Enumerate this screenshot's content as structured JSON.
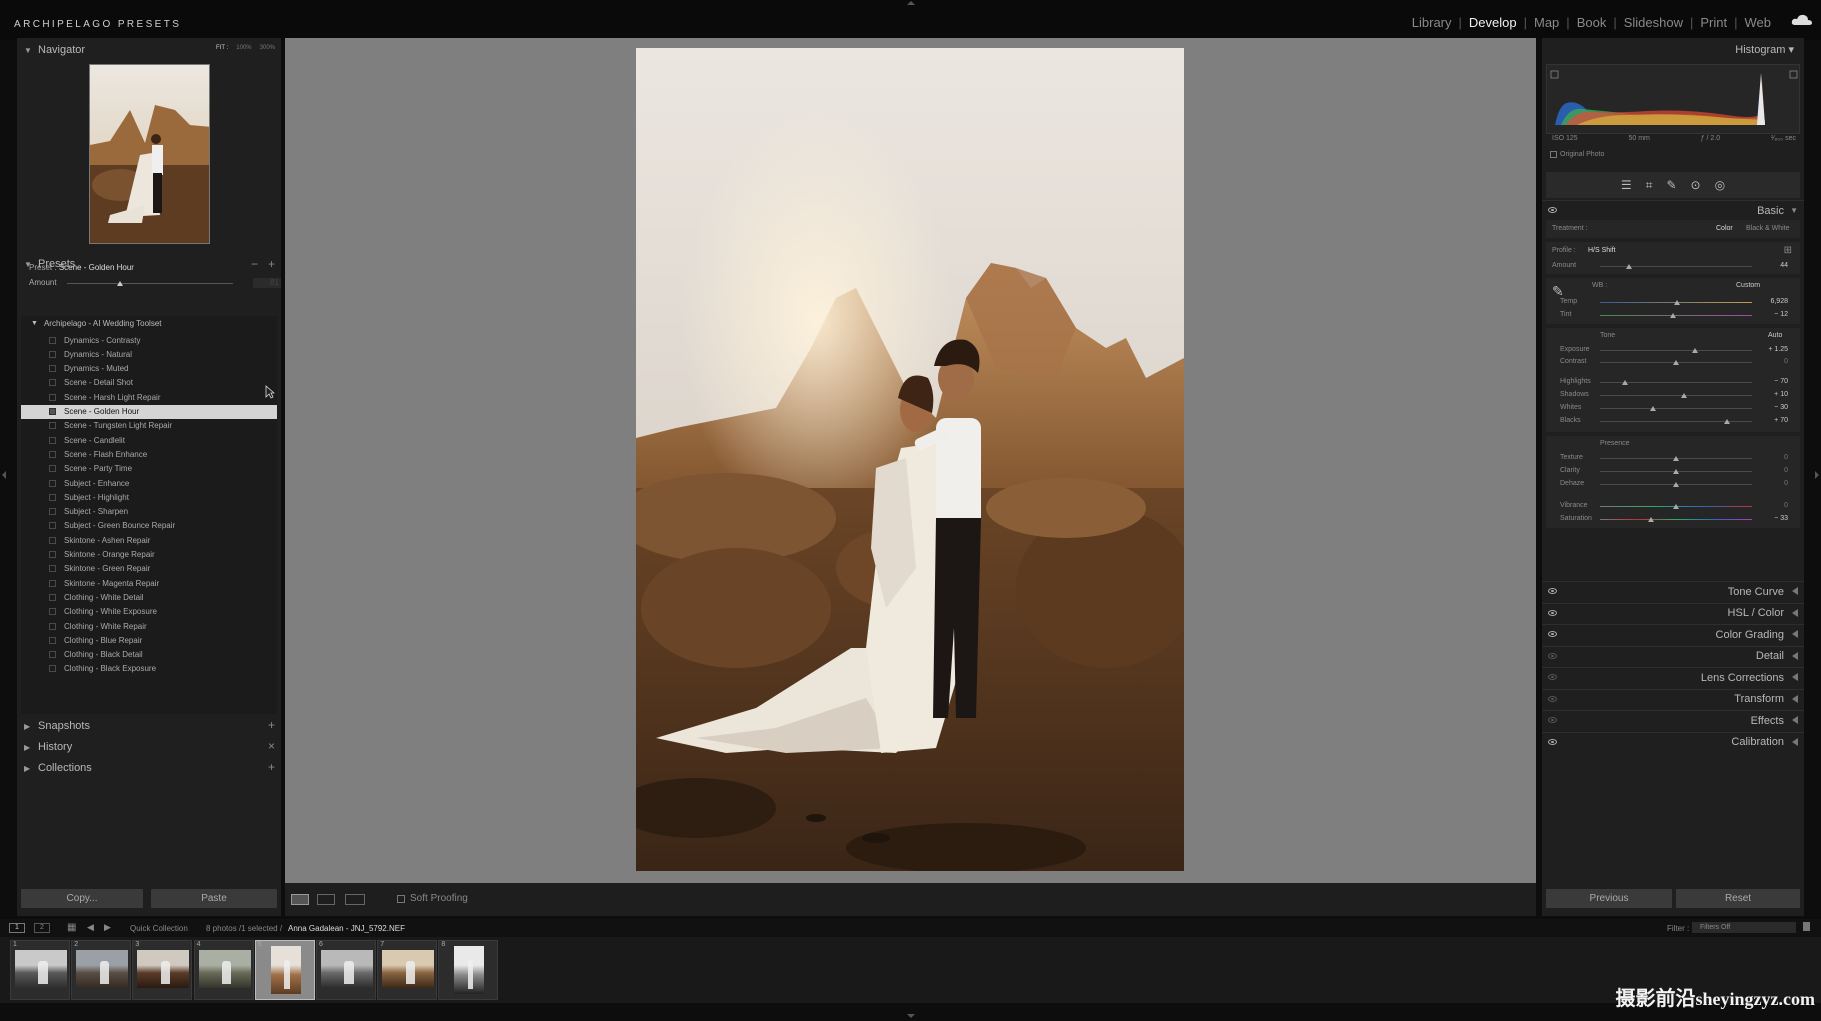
{
  "app": {
    "brand": "ARCHIPELAGO PRESETS"
  },
  "modules": [
    "Library",
    "Develop",
    "Map",
    "Book",
    "Slideshow",
    "Print",
    "Web"
  ],
  "active_module": "Develop",
  "navigator": {
    "title": "Navigator",
    "zoom": [
      "FIT :",
      "100%",
      "300%"
    ]
  },
  "preset_info": {
    "preset_label": "Preset :",
    "preset_name": "Scene - Golden Hour",
    "amount_label": "Amount",
    "amount_value": "81"
  },
  "presets_panel": {
    "title": "Presets",
    "folder": "Archipelago - AI Wedding Toolset",
    "items": [
      "Dynamics - Contrasty",
      "Dynamics - Natural",
      "Dynamics - Muted",
      "Scene - Detail Shot",
      "Scene - Harsh Light Repair",
      "Scene - Golden Hour",
      "Scene - Tungsten Light Repair",
      "Scene - Candlelit",
      "Scene - Flash Enhance",
      "Scene - Party Time",
      "Subject - Enhance",
      "Subject - Highlight",
      "Subject - Sharpen",
      "Subject - Green Bounce Repair",
      "Skintone - Ashen Repair",
      "Skintone - Orange Repair",
      "Skintone - Green Repair",
      "Skintone - Magenta Repair",
      "Clothing - White Detail",
      "Clothing - White Exposure",
      "Clothing - White Repair",
      "Clothing - Blue Repair",
      "Clothing - Black Detail",
      "Clothing - Black Exposure"
    ],
    "selected_index": 5
  },
  "left_sections": [
    {
      "name": "Snapshots",
      "action": "+"
    },
    {
      "name": "History",
      "action": "×"
    },
    {
      "name": "Collections",
      "action": "+"
    }
  ],
  "left_buttons": {
    "copy": "Copy...",
    "paste": "Paste"
  },
  "toolbar": {
    "soft_proofing": "Soft Proofing"
  },
  "histogram": {
    "title": "Histogram",
    "iso": "ISO 125",
    "focal": "50 mm",
    "aperture": "ƒ / 2.0",
    "shutter": "¹⁄₈₀₀ sec",
    "original_photo": "Original Photo"
  },
  "basic": {
    "title": "Basic",
    "treatment_label": "Treatment :",
    "treatment_color": "Color",
    "treatment_bw": "Black & White",
    "profile_label": "Profile :",
    "profile_value": "H/S Shift",
    "amount_label": "Amount",
    "amount_value": "44",
    "wb_label": "WB :",
    "wb_value": "Custom",
    "temp_label": "Temp",
    "temp_value": "6,928",
    "tint_label": "Tint",
    "tint_value": "− 12",
    "tone_label": "Tone",
    "auto_label": "Auto",
    "exposure_label": "Exposure",
    "exposure_value": "+ 1.25",
    "contrast_label": "Contrast",
    "contrast_value": "0",
    "highlights_label": "Highlights",
    "highlights_value": "− 70",
    "shadows_label": "Shadows",
    "shadows_value": "+ 10",
    "whites_label": "Whites",
    "whites_value": "− 30",
    "blacks_label": "Blacks",
    "blacks_value": "+ 70",
    "presence_label": "Presence",
    "texture_label": "Texture",
    "texture_value": "0",
    "clarity_label": "Clarity",
    "clarity_value": "0",
    "dehaze_label": "Dehaze",
    "dehaze_value": "0",
    "vibrance_label": "Vibrance",
    "vibrance_value": "0",
    "saturation_label": "Saturation",
    "saturation_value": "− 33"
  },
  "right_sections": [
    "Tone Curve",
    "HSL / Color",
    "Color Grading",
    "Detail",
    "Lens Corrections",
    "Transform",
    "Effects",
    "Calibration"
  ],
  "right_buttons": {
    "previous": "Previous",
    "reset": "Reset"
  },
  "filmstrip_bar": {
    "view1": "1",
    "view2": "2",
    "source": "Quick Collection",
    "count": "8 photos /1 selected /",
    "filename": "Anna Gadalean - JNJ_5792.NEF",
    "filter_label": "Filter :",
    "filter_value": "Filters Off"
  },
  "filmstrip": {
    "numbers": [
      "1",
      "2",
      "3",
      "4",
      "5",
      "6",
      "7",
      "8"
    ],
    "selected_index": 4
  },
  "watermark": {
    "cn": "摄影前沿",
    "latin": "sheyingzyz.com"
  },
  "colors": {
    "panel": "#1f1f1f",
    "center_bg": "#7f7f7f",
    "selected_row": "#d4d4d4"
  }
}
